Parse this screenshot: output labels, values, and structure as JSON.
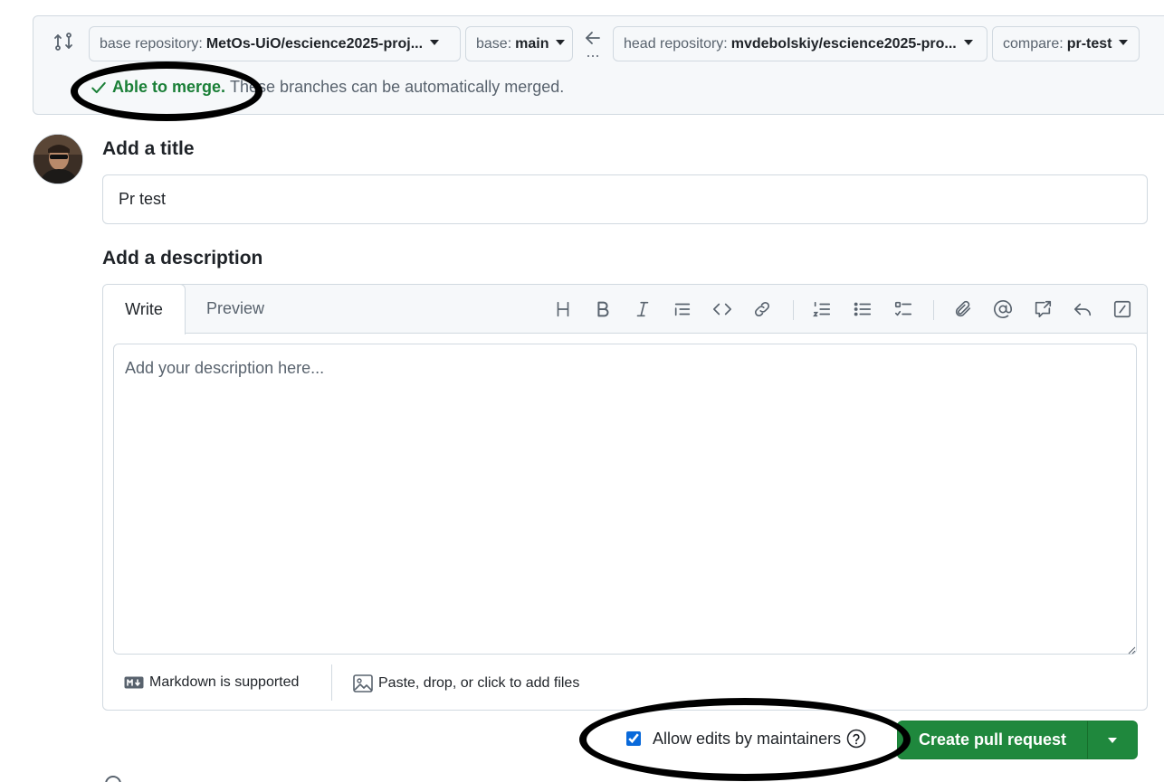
{
  "compare": {
    "base_repo_label": "base repository:",
    "base_repo_value": "MetOs-UiO/escience2025-proj...",
    "base_label": "base:",
    "base_value": "main",
    "head_repo_label": "head repository:",
    "head_repo_value": "mvdebolskiy/escience2025-pro...",
    "compare_label": "compare:",
    "compare_value": "pr-test",
    "merge_status": "Able to merge.",
    "merge_detail": "These branches can be automatically merged."
  },
  "form": {
    "title_heading": "Add a title",
    "title_value": "Pr test",
    "description_heading": "Add a description",
    "tab_write": "Write",
    "tab_preview": "Preview",
    "description_placeholder": "Add your description here...",
    "markdown_note": "Markdown is supported",
    "files_note": "Paste, drop, or click to add files"
  },
  "toolbar": [
    "heading-icon",
    "bold-icon",
    "italic-icon",
    "quote-icon",
    "code-icon",
    "link-icon",
    "ordered-list-icon",
    "unordered-list-icon",
    "task-list-icon",
    "attach-icon",
    "mention-icon",
    "reference-icon",
    "reply-icon",
    "slash-command-icon"
  ],
  "actions": {
    "allow_edits_label": "Allow edits by maintainers",
    "allow_edits_checked": true,
    "create_label": "Create pull request"
  },
  "colors": {
    "success": "#1a7f37",
    "primary_button": "#1f883d",
    "accent": "#0969da",
    "muted_text": "#59636e",
    "border": "#d1d9e0",
    "surface": "#f6f8fa"
  }
}
